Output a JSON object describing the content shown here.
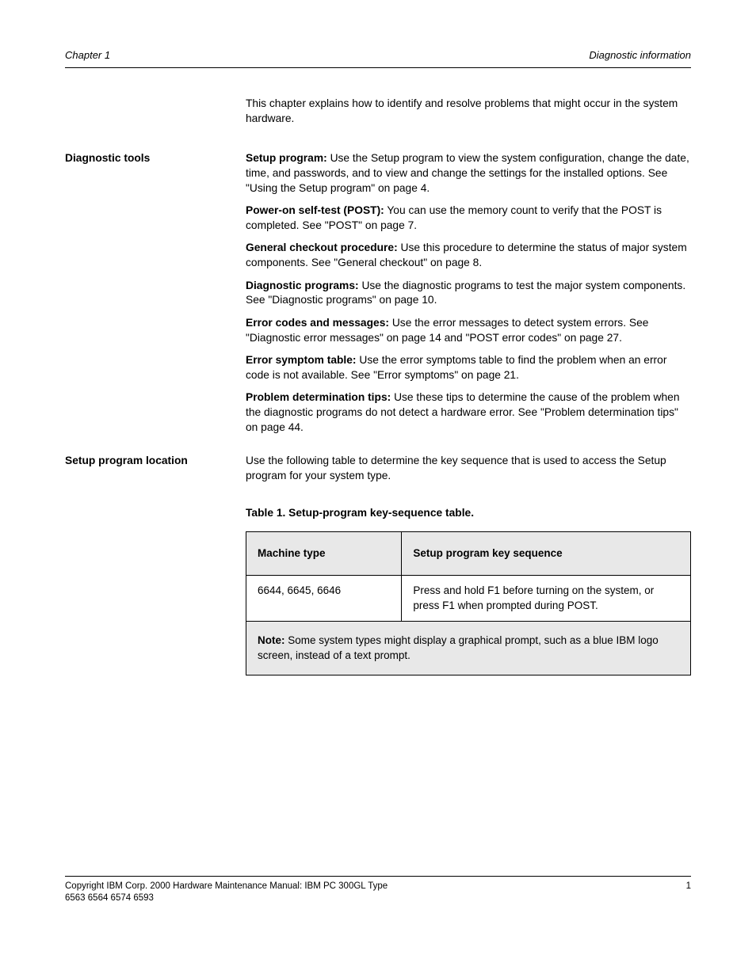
{
  "header": {
    "left": "Chapter 1",
    "right": "Diagnostic information"
  },
  "intro": "This chapter explains how to identify and resolve problems that might occur in the system hardware.",
  "sections": [
    {
      "label": "Diagnostic tools",
      "paragraphs": [
        {
          "text": "Use the Setup program to view the system configuration, change the date, time, and passwords, and to view and change the settings for the installed options. See \"Using the Setup program\" on page 4.",
          "leadBold": "Setup program:"
        },
        {
          "text": "You can use the memory count to verify that the POST is completed. See \"POST\" on page 7.",
          "leadBold": "Power-on self-test (POST):"
        },
        {
          "text": "Use this procedure to determine the status of major system components. See \"General checkout\" on page 8.",
          "leadBold": "General checkout procedure:"
        },
        {
          "text": "Use the diagnostic programs to test the major system components. See \"Diagnostic programs\" on page 10.",
          "leadBold": "Diagnostic programs:"
        },
        {
          "text": "Use the error messages to detect system errors. See \"Diagnostic error messages\" on page 14 and \"POST error codes\" on page 27.",
          "leadBold": "Error codes and messages:"
        },
        {
          "text": "Use the error symptoms table to find the problem when an error code is not available. See \"Error symptoms\" on page 21.",
          "leadBold": "Error symptom table:"
        },
        {
          "text": "Use these tips to determine the cause of the problem when the diagnostic programs do not detect a hardware error. See \"Problem determination tips\" on page 44.",
          "leadBold": "Problem determination tips:"
        }
      ]
    },
    {
      "label": "Setup program location",
      "paragraphs": [
        {
          "text": "Use the following table to determine the key sequence that is used to access the Setup program for your system type."
        }
      ]
    }
  ],
  "tableCaption": "Table 1. Setup-program key-sequence table.",
  "table": {
    "headers": [
      "Machine type",
      "Setup program key sequence"
    ],
    "rows": [
      [
        "6644, 6645, 6646",
        "Press and hold F1 before turning on the system, or press F1 when prompted during POST."
      ]
    ],
    "note": {
      "label": "Note:",
      "text": "Some system types might display a graphical prompt, such as a blue IBM logo screen, instead of a text prompt."
    }
  },
  "footer": {
    "left": "Copyright IBM Corp. 2000 Hardware Maintenance Manual: IBM PC 300GL Type 6563 6564 6574 6593",
    "right": "1"
  }
}
